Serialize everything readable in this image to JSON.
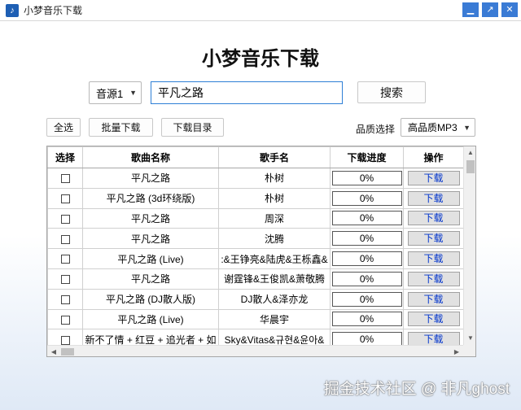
{
  "window": {
    "title": "小梦音乐下载",
    "controls": [
      "close-x-icon",
      "maximize-icon",
      "close-icon"
    ]
  },
  "app": {
    "title": "小梦音乐下载"
  },
  "search": {
    "source_selected": "音源1",
    "query": "平凡之路",
    "button": "搜索"
  },
  "toolbar": {
    "select_all": "全选",
    "batch_download": "批量下载",
    "download_dir": "下载目录",
    "quality_label": "品质选择",
    "quality_selected": "高品质MP3"
  },
  "table": {
    "headers": {
      "select": "选择",
      "song": "歌曲名称",
      "singer": "歌手名",
      "progress": "下载进度",
      "action": "操作"
    },
    "rows": [
      {
        "song": "平凡之路",
        "singer": "朴树",
        "progress": "0%",
        "action": "下载"
      },
      {
        "song": "平凡之路 (3d环绕版)",
        "singer": "朴树",
        "progress": "0%",
        "action": "下载"
      },
      {
        "song": "平凡之路",
        "singer": "周深",
        "progress": "0%",
        "action": "下载"
      },
      {
        "song": "平凡之路",
        "singer": "沈腾",
        "progress": "0%",
        "action": "下载"
      },
      {
        "song": "平凡之路 (Live)",
        "singer": ":&王铮亮&陆虎&王栎鑫&",
        "progress": "0%",
        "action": "下载"
      },
      {
        "song": "平凡之路",
        "singer": "谢霆锋&王俊凯&萧敬腾",
        "progress": "0%",
        "action": "下载"
      },
      {
        "song": "平凡之路 (DJ散人版)",
        "singer": "DJ散人&泽亦龙",
        "progress": "0%",
        "action": "下载"
      },
      {
        "song": "平凡之路 (Live)",
        "singer": "华晨宇",
        "progress": "0%",
        "action": "下载"
      },
      {
        "song": "新不了情 + 红豆 + 追光者 + 如",
        "singer": "Sky&Vitas&규현&윤아&",
        "progress": "0%",
        "action": "下载"
      }
    ]
  },
  "watermark": "掘金技术社区 @ 非凡ghost",
  "colors": {
    "accent": "#3a7bd5",
    "link_blue": "#0033cc",
    "input_border": "#2e7fd6"
  }
}
